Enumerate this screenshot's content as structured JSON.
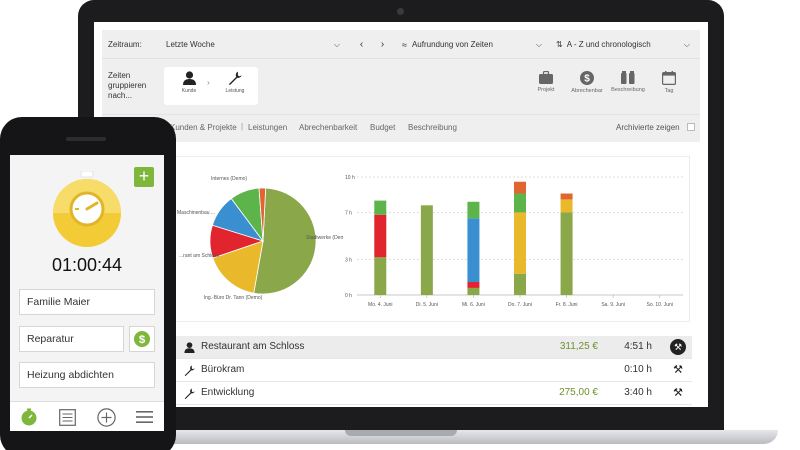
{
  "toolbar": {
    "period_label": "Zeitraum:",
    "period_value": "Letzte Woche",
    "rounding_value": "Aufrundung von Zeiten",
    "sort_value": "A - Z und chronologisch",
    "group_label": "Zeiten gruppieren nach...",
    "group_items": [
      {
        "label": "Kunde",
        "icon": "user-icon"
      },
      {
        "label": "Leistung",
        "icon": "wrench-icon"
      }
    ],
    "buttons": [
      {
        "label": "Projekt",
        "icon": "briefcase-icon"
      },
      {
        "label": "Abrechenbar",
        "icon": "dollar-icon"
      },
      {
        "label": "Beschreibung",
        "icon": "quote-icon"
      },
      {
        "label": "Tag",
        "icon": "calendar-icon"
      }
    ]
  },
  "tabs": {
    "items": [
      "Kunden & Projekte",
      "Leistungen",
      "Abrechenbarkeit",
      "Budget",
      "Beschreibung"
    ],
    "archive_label": "Archivierte zeigen"
  },
  "colors": {
    "green": "#8aa84a",
    "green2": "#5db44b",
    "red": "#e1252e",
    "blue": "#3a8fd0",
    "yellow": "#e9b92b",
    "orange": "#e06530",
    "accent_green": "#7fb63c"
  },
  "chart_data": [
    {
      "type": "pie",
      "labels": [
        "Stadtwerke (Demo)",
        "Ing.-Büro Dr. Tann (Demo)",
        "...rant am Schloss",
        "Maschinenbau ...",
        "Internes (Demo)",
        ""
      ],
      "values": [
        52,
        17,
        10,
        10,
        9,
        2
      ],
      "colors": [
        "#8aa84a",
        "#e9b92b",
        "#e1252e",
        "#3a8fd0",
        "#5db44b",
        "#e06530"
      ]
    },
    {
      "type": "bar",
      "stacked": true,
      "categories": [
        "Mo. 4. Juni",
        "Di. 5. Juni",
        "Mi. 6. Juni",
        "Do. 7. Juni",
        "Fr. 8. Juni",
        "Sa. 9. Juni",
        "So. 10. Juni"
      ],
      "yticks": [
        "0 h",
        "3 h",
        "7 h",
        "10 h"
      ],
      "ylim": [
        0,
        10
      ],
      "series": [
        {
          "color": "#8aa84a",
          "values": [
            3.2,
            7.6,
            0.6,
            1.8,
            7.0,
            0,
            0
          ]
        },
        {
          "color": "#e1252e",
          "values": [
            3.6,
            0,
            0.5,
            0,
            0,
            0,
            0
          ]
        },
        {
          "color": "#3a8fd0",
          "values": [
            0,
            0,
            5.4,
            0,
            0,
            0,
            0
          ]
        },
        {
          "color": "#e9b92b",
          "values": [
            0,
            0,
            0,
            5.2,
            1.1,
            0,
            0
          ]
        },
        {
          "color": "#5db44b",
          "values": [
            1.2,
            0,
            1.4,
            1.6,
            0,
            0,
            0
          ]
        },
        {
          "color": "#e06530",
          "values": [
            0,
            0,
            0,
            1.0,
            0.5,
            0,
            0
          ]
        }
      ]
    }
  ],
  "list": {
    "rows": [
      {
        "name": "Restaurant am Schloss",
        "amount": "311,25 €",
        "time": "4:51 h",
        "icon": "user-icon"
      },
      {
        "name": "Bürokram",
        "amount": "",
        "time": "0:10 h",
        "icon": "wrench-icon"
      },
      {
        "name": "Entwicklung",
        "amount": "275,00 €",
        "time": "3:40 h",
        "icon": "wrench-icon"
      }
    ]
  },
  "phone": {
    "timer": "01:00:44",
    "fields": [
      "Familie Maier",
      "Reparatur",
      "Heizung abdichten"
    ],
    "nav": [
      "stopwatch-icon",
      "list-icon",
      "add-icon",
      "menu-icon"
    ]
  }
}
